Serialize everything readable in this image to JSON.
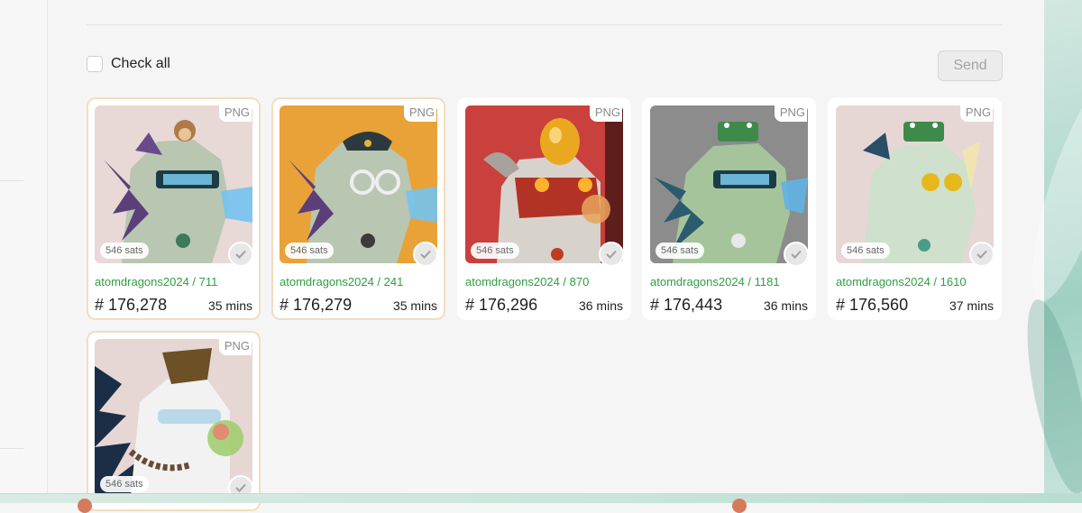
{
  "toolbar": {
    "check_all_label": "Check all",
    "send_label": "Send"
  },
  "colors": {
    "accent_green": "#2f9e44",
    "selected_border": "#f2ddc0"
  },
  "cards": [
    {
      "format": "PNG",
      "price": "546 sats",
      "name": "atomdragons2024 / 711",
      "number": "# 176,278",
      "time": "35 mins",
      "selected": true,
      "bg": "#e8d8d6",
      "art": "monkey-gm-dragon"
    },
    {
      "format": "PNG",
      "price": "546 sats",
      "name": "atomdragons2024 / 241",
      "number": "# 176,279",
      "time": "35 mins",
      "selected": true,
      "bg": "#e8a238",
      "art": "hat-glasses-dragon"
    },
    {
      "format": "PNG",
      "price": "546 sats",
      "name": "atomdragons2024 / 870",
      "number": "# 176,296",
      "time": "36 mins",
      "selected": false,
      "bg": "#c9403c",
      "art": "golden-egg-dragon"
    },
    {
      "format": "PNG",
      "price": "546 sats",
      "name": "atomdragons2024 / 1181",
      "number": "# 176,443",
      "time": "36 mins",
      "selected": false,
      "bg": "#8c8c8c",
      "art": "crocodile-gm-dragon"
    },
    {
      "format": "PNG",
      "price": "546 sats",
      "name": "atomdragons2024 / 1610",
      "number": "# 176,560",
      "time": "37 mins",
      "selected": false,
      "bg": "#e6d7d5",
      "art": "coin-glasses-dragon"
    },
    {
      "format": "PNG",
      "price": "546 sats",
      "selected": true,
      "bg": "#e6d7d5",
      "art": "graduation-cap-dragon"
    }
  ]
}
